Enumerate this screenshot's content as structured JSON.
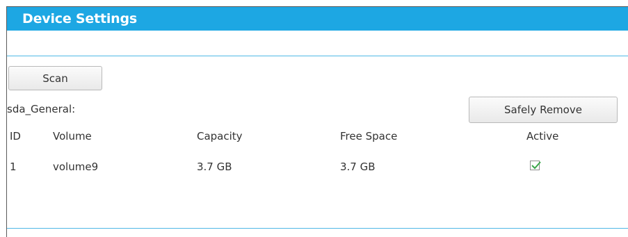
{
  "header": {
    "title": "Device Settings"
  },
  "actions": {
    "scan_label": "Scan",
    "safely_remove_label": "Safely Remove"
  },
  "device": {
    "name": "sda_General:"
  },
  "table": {
    "columns": [
      "ID",
      "Volume",
      "Capacity",
      "Free Space",
      "Active"
    ],
    "rows": [
      {
        "id": "1",
        "volume": "volume9",
        "capacity": "3.7 GB",
        "free_space": "3.7 GB",
        "active": true
      }
    ]
  },
  "colors": {
    "header_bg": "#1da7e3",
    "rule": "#4fb8e6",
    "check": "#3aa64a"
  }
}
